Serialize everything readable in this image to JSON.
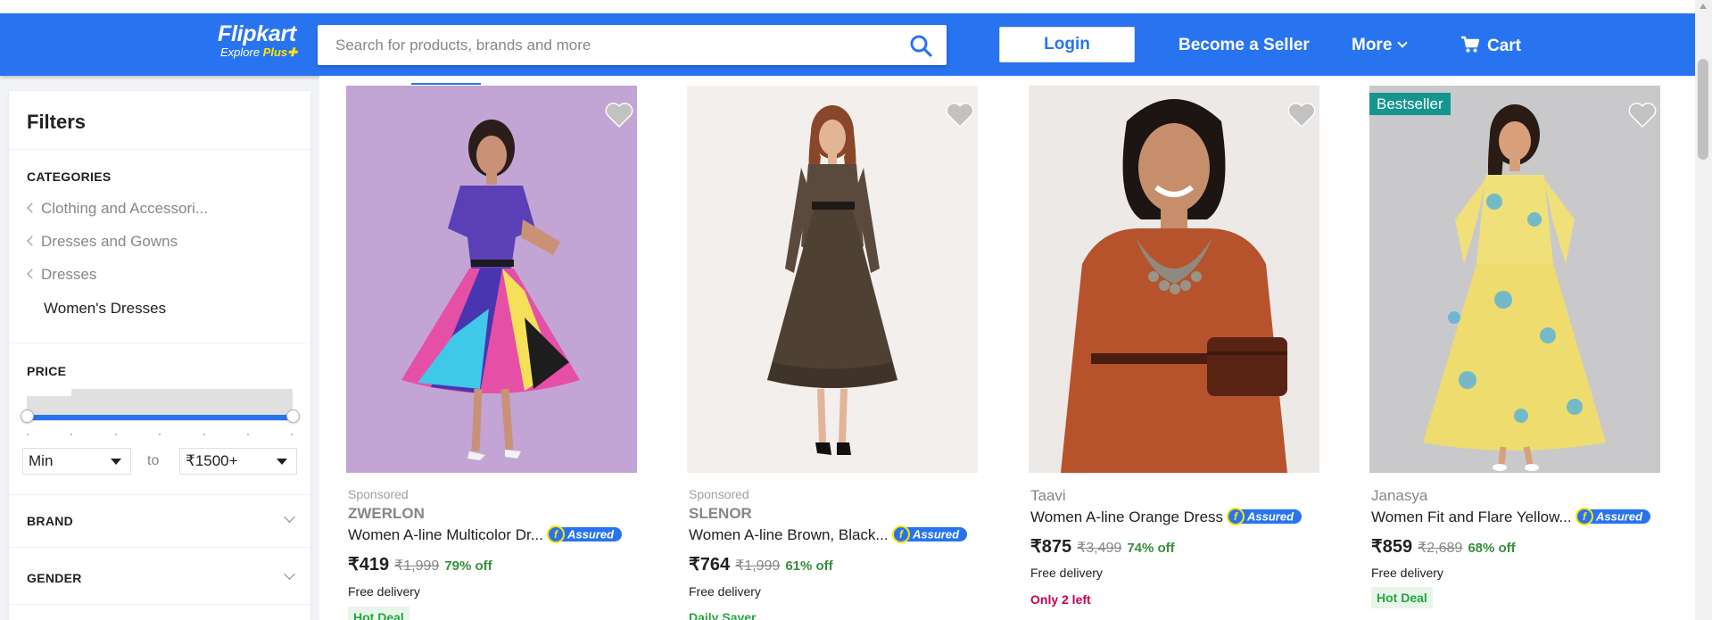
{
  "header": {
    "logo_text": "Flipkart",
    "logo_sub": "Explore",
    "logo_plus": "Plus",
    "search_placeholder": "Search for products, brands and more",
    "login_label": "Login",
    "become_seller": "Become a Seller",
    "more": "More",
    "cart": "Cart",
    "brand_color": "#2874f0"
  },
  "sidebar": {
    "title": "Filters",
    "categories_heading": "CATEGORIES",
    "categories": [
      "Clothing and Accessori...",
      "Dresses and Gowns",
      "Dresses"
    ],
    "current_category": "Women's Dresses",
    "price_heading": "PRICE",
    "price_min": "Min",
    "price_to": "to",
    "price_max": "₹1500+",
    "brand_heading": "BRAND",
    "gender_heading": "GENDER"
  },
  "products": [
    {
      "sponsored": "Sponsored",
      "brand": "ZWERLON",
      "title": "Women A-line Multicolor Dr...",
      "price": "₹419",
      "mrp": "₹1,999",
      "discount": "79% off",
      "delivery": "Free delivery",
      "tag": "Hot Deal",
      "image_desc": "woman in multicolor pleated dress on lavender background"
    },
    {
      "sponsored": "Sponsored",
      "brand": "SLENOR",
      "title": "Women A-line Brown, Black...",
      "price": "₹764",
      "mrp": "₹1,999",
      "discount": "61% off",
      "delivery": "Free delivery",
      "tag": "Daily Saver",
      "image_desc": "woman in brown leopard print dress"
    },
    {
      "brand": "Taavi",
      "title": "Women A-line Orange Dress",
      "price": "₹875",
      "mrp": "₹3,499",
      "discount": "74% off",
      "delivery": "Free delivery",
      "tag": "Only 2 left",
      "image_desc": "woman in orange dress with belt bag"
    },
    {
      "badge": "Bestseller",
      "brand": "Janasya",
      "title": "Women Fit and Flare Yellow...",
      "price": "₹859",
      "mrp": "₹2,689",
      "discount": "68% off",
      "delivery": "Free delivery",
      "tag": "Hot Deal",
      "image_desc": "woman in yellow floral fit and flare dress"
    }
  ],
  "assured_label": "Assured",
  "icons": {
    "search": "search-icon",
    "cart": "cart-icon",
    "wishlist": "heart-icon"
  }
}
